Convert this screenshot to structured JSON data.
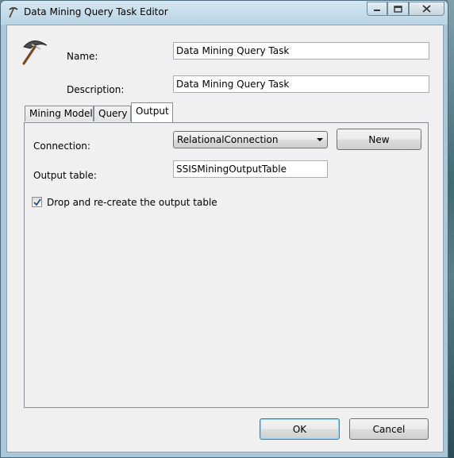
{
  "window": {
    "title": "Data Mining Query Task Editor"
  },
  "header": {
    "icon": "pickaxe-icon",
    "name_label": "Name:",
    "name_value": "Data Mining Query Task",
    "description_label": "Description:",
    "description_value": "Data Mining Query Task"
  },
  "tabs": [
    {
      "label": "Mining Model",
      "active": false
    },
    {
      "label": "Query",
      "active": false
    },
    {
      "label": "Output",
      "active": true
    }
  ],
  "output": {
    "connection_label": "Connection:",
    "connection_value": "RelationalConnection",
    "new_button": "New",
    "output_table_label": "Output table:",
    "output_table_value": "SSISMiningOutputTable",
    "drop_checkbox_label": "Drop and re-create the output table",
    "drop_checked": true
  },
  "footer": {
    "ok_button": "OK",
    "cancel_button": "Cancel"
  }
}
